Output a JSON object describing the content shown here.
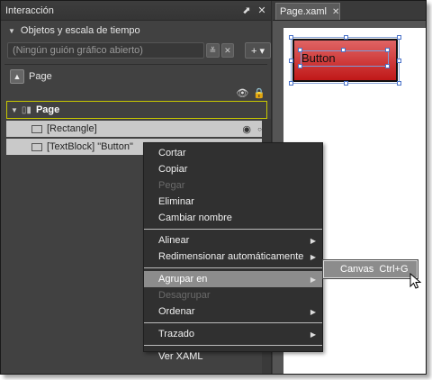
{
  "panel": {
    "title": "Interacción",
    "section_title": "Objetos y escala de tiempo",
    "storyboard_combo": "(Ningún guión gráfico abierto)",
    "add_storyboard": "+ ▾",
    "scope_up_label": "Page"
  },
  "tree": {
    "root_label": "Page",
    "items": [
      {
        "label": "[Rectangle]"
      },
      {
        "label": "[TextBlock] \"Button\""
      }
    ]
  },
  "document": {
    "tab_label": "Page.xaml",
    "button_text": "Button"
  },
  "context_menu": {
    "items": [
      {
        "label": "Cortar",
        "disabled": false
      },
      {
        "label": "Copiar",
        "disabled": false
      },
      {
        "label": "Pegar",
        "disabled": true
      },
      {
        "label": "Eliminar",
        "disabled": false
      },
      {
        "label": "Cambiar nombre",
        "disabled": false
      },
      {
        "label": "Alinear",
        "submenu": true
      },
      {
        "label": "Redimensionar automáticamente",
        "submenu": true
      },
      {
        "label": "Agrupar en",
        "submenu": true,
        "highlighted": true
      },
      {
        "label": "Desagrupar",
        "disabled": true
      },
      {
        "label": "Ordenar",
        "submenu": true
      },
      {
        "label": "Trazado",
        "submenu": true
      },
      {
        "label": "Ver XAML"
      }
    ],
    "submenu_item": "Canvas  Ctrl+G"
  },
  "colors": {
    "panel_bg": "#414141",
    "tree_highlight_border": "#c8c800",
    "button_fill": "#d03030",
    "menu_highlight": "#8c8c8c"
  },
  "icons": [
    "pin-icon",
    "close-icon",
    "chevron-down-icon",
    "clear-icon",
    "up-scope-icon",
    "eye-icon",
    "lock-icon",
    "page-icon",
    "rectangle-icon",
    "textblock-icon",
    "submenu-arrow-icon",
    "mouse-cursor-icon"
  ]
}
